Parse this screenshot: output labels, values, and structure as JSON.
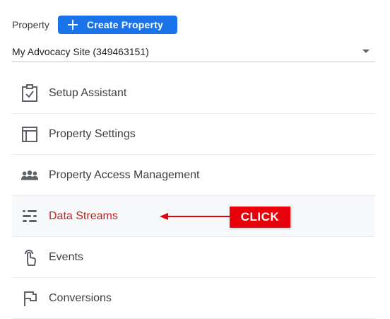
{
  "header": {
    "label": "Property",
    "create_button_label": "Create Property",
    "create_button_icon": "plus-icon"
  },
  "property_selector": {
    "value": "My Advocacy Site (349463151)",
    "icon": "chevron-down-icon"
  },
  "nav": {
    "items": [
      {
        "label": "Setup Assistant",
        "icon": "clipboard-check-icon",
        "active": false
      },
      {
        "label": "Property Settings",
        "icon": "window-layout-icon",
        "active": false
      },
      {
        "label": "Property Access Management",
        "icon": "people-icon",
        "active": false
      },
      {
        "label": "Data Streams",
        "icon": "data-streams-icon",
        "active": true
      },
      {
        "label": "Events",
        "icon": "touch-hand-icon",
        "active": false
      },
      {
        "label": "Conversions",
        "icon": "flag-icon",
        "active": false
      }
    ]
  },
  "annotation": {
    "label": "CLICK",
    "color": "#e8000b"
  },
  "colors": {
    "primary_button": "#1a73e8",
    "active_label": "#c5221f",
    "annotation_red": "#e8000b"
  }
}
